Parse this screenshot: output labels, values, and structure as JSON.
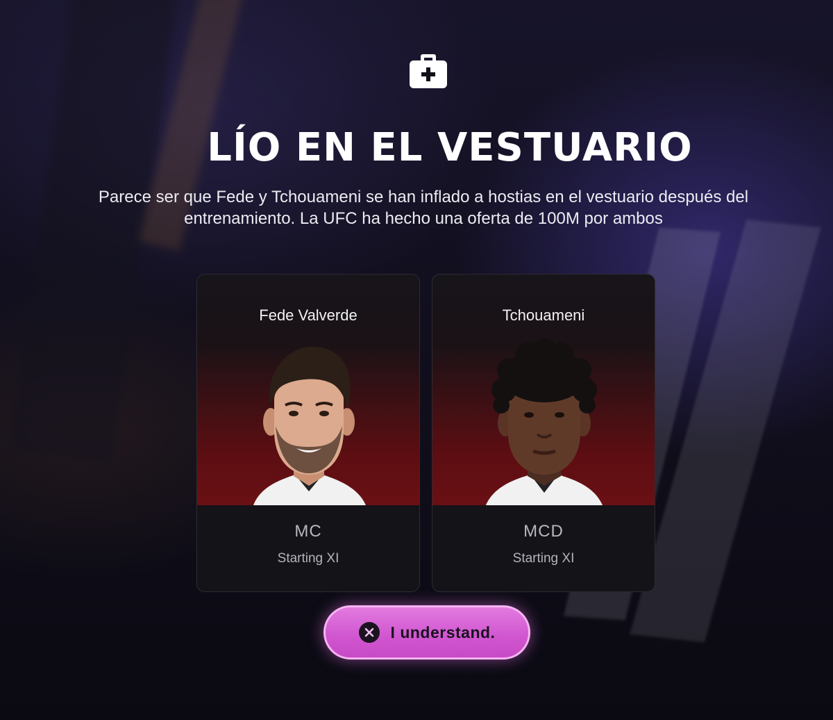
{
  "header": {
    "icon": "first-aid-kit-icon",
    "title": "LÍO EN EL VESTUARIO",
    "description": "Parece ser que Fede y Tchouameni se han inflado a hostias en el vestuario después del entrenamiento. La UFC ha hecho una oferta de 100M por ambos"
  },
  "players": [
    {
      "name": "Fede Valverde",
      "position": "MC",
      "status": "Starting XI",
      "photo": "player-portrait"
    },
    {
      "name": "Tchouameni",
      "position": "MCD",
      "status": "Starting XI",
      "photo": "player-portrait"
    }
  ],
  "actions": {
    "confirm_label": "I understand.",
    "confirm_icon": "close-circle-icon"
  },
  "colors": {
    "accent": "#d055cf",
    "accent_border": "#f7b4f2",
    "card_glow": "#6a1014"
  }
}
